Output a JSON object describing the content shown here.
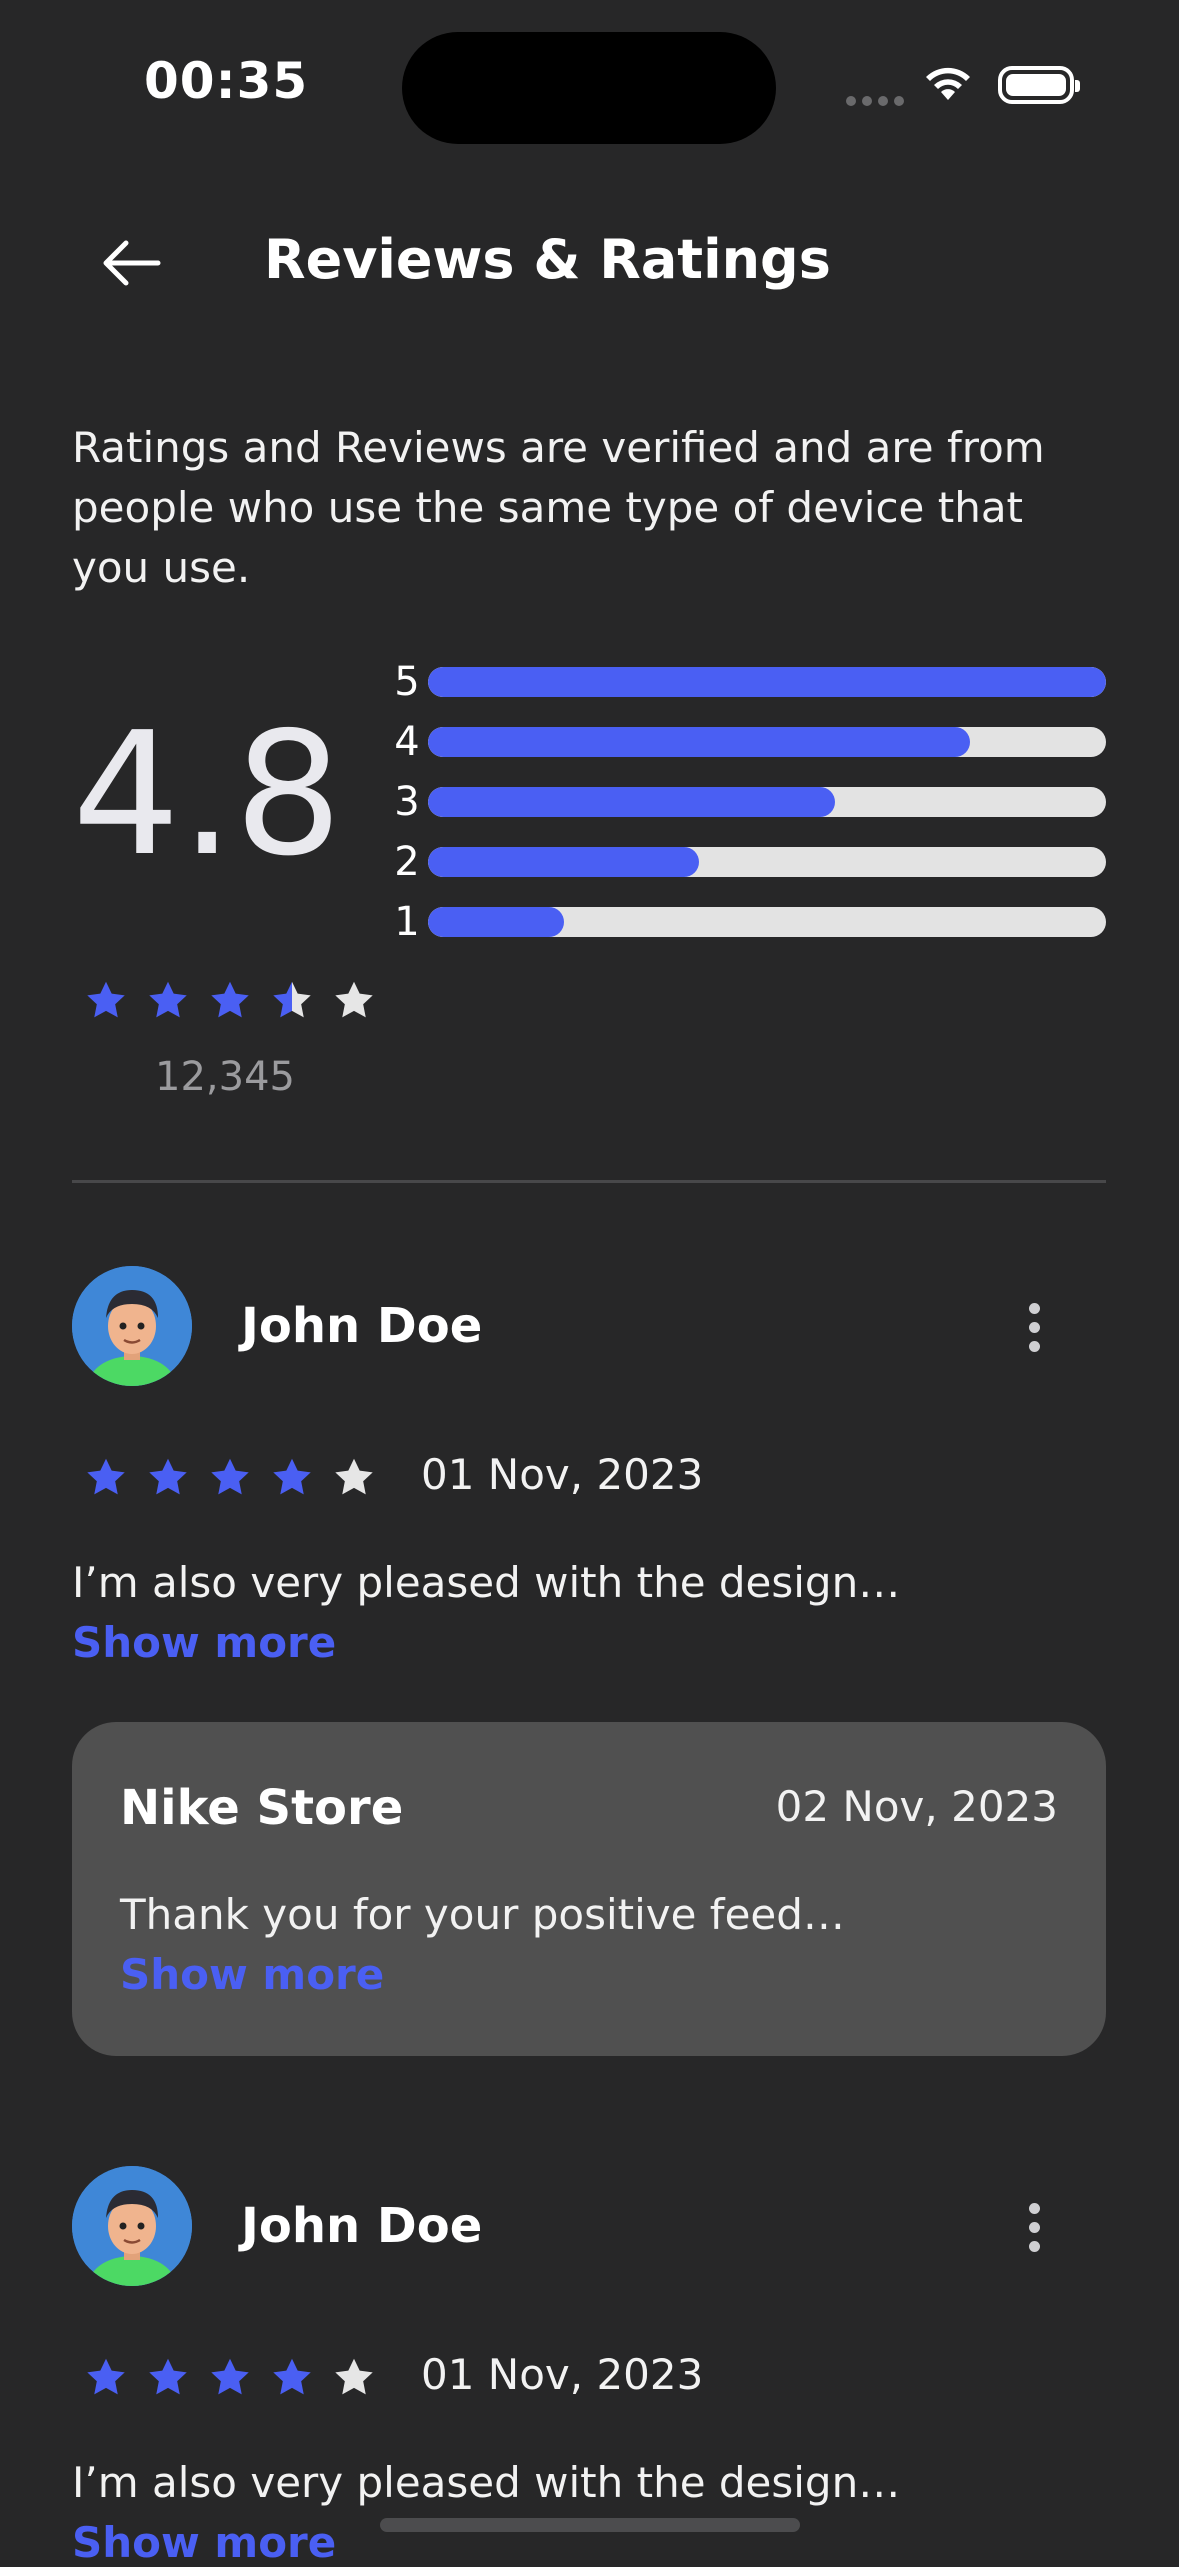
{
  "status_bar": {
    "time": "00:35"
  },
  "header": {
    "title": "Reviews & Ratings"
  },
  "intro": "Ratings and Reviews are verified and are from people who use the same type of device that you use.",
  "summary": {
    "rating": "4.8",
    "count": "12,345",
    "stars_filled": 3.5,
    "distribution": [
      {
        "label": "5",
        "fraction": 1.0
      },
      {
        "label": "4",
        "fraction": 0.8
      },
      {
        "label": "3",
        "fraction": 0.6
      },
      {
        "label": "2",
        "fraction": 0.4
      },
      {
        "label": "1",
        "fraction": 0.2
      }
    ]
  },
  "reviews": [
    {
      "name": "John Doe",
      "stars": 4,
      "date": "01 Nov, 2023",
      "text": "I’m also very pleased with the design…",
      "show_more": "Show more",
      "reply": {
        "store": "Nike Store",
        "date": "02 Nov, 2023",
        "text": "Thank you for your positive feed…",
        "show_more": "Show more"
      }
    },
    {
      "name": "John Doe",
      "stars": 4,
      "date": "01 Nov, 2023",
      "text": "I’m also very pleased with the design…",
      "show_more": "Show more"
    }
  ],
  "colors": {
    "accent": "#4a5ff3",
    "background": "#272728",
    "card": "#505050",
    "star_empty": "#e6e6e6"
  },
  "icons": [
    "back-arrow-icon",
    "wifi-icon",
    "battery-icon",
    "star-icon",
    "more-vertical-icon"
  ]
}
